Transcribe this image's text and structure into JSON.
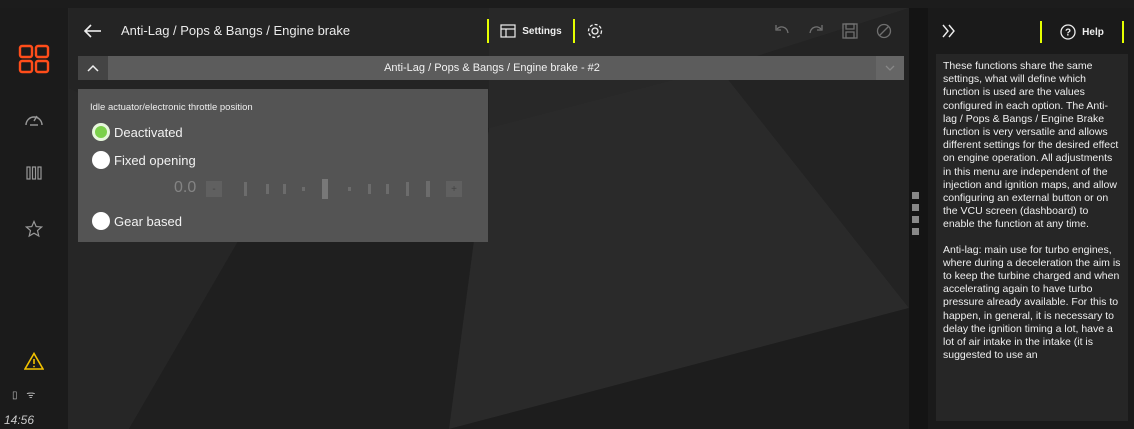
{
  "sidebar": {
    "items": [
      {
        "icon": "apps-grid-icon"
      },
      {
        "icon": "speedometer-icon"
      },
      {
        "icon": "columns-icon"
      },
      {
        "icon": "star-icon"
      }
    ],
    "warning_icon": "warning-icon",
    "status_icons": "battery-wifi",
    "time": "14:56"
  },
  "header": {
    "breadcrumb": "Anti-Lag / Pops & Bangs / Engine brake",
    "settings_label": "Settings"
  },
  "section": {
    "title": "Anti-Lag / Pops & Bangs / Engine brake - #2"
  },
  "panel": {
    "label": "Idle actuator/electronic throttle position",
    "options": [
      {
        "label": "Deactivated",
        "selected": true
      },
      {
        "label": "Fixed opening",
        "selected": false
      },
      {
        "label": "Gear based",
        "selected": false
      }
    ],
    "stepper": {
      "value": "0.0",
      "minus": "-",
      "plus": "+"
    }
  },
  "help": {
    "label": "Help",
    "paragraphs": [
      "These functions share the same settings, what will define which function is used are the values configured in each option. The Anti-lag / Pops & Bangs / Engine Brake function is very versatile and allows different settings for the desired effect on engine operation. All adjustments in this menu are independent of the injection and ignition maps, and allow configuring an external button or on the VCU screen (dashboard) to enable the function at any time.",
      "Anti-lag: main use for turbo engines, where during a deceleration the aim is to keep the turbine charged and when accelerating again to have turbo pressure already available. For this to happen, in general, it is necessary to delay the ignition timing a lot, have a lot of air intake in the intake (it is suggested to use an"
    ]
  },
  "colors": {
    "accent": "#e5ff00",
    "brand": "#ff4d1a",
    "selected_radio": "#7bd14a",
    "warning": "#f2c200"
  }
}
